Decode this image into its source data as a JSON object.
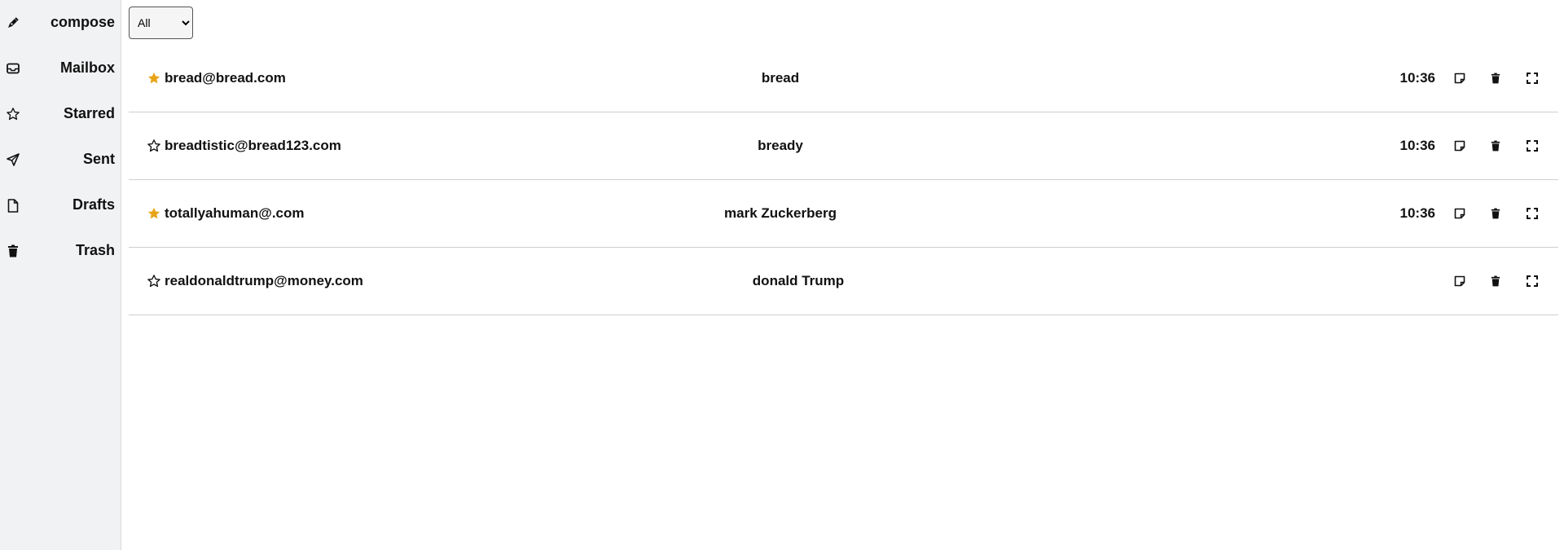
{
  "sidebar": {
    "items": [
      {
        "label": "compose",
        "icon": "pen-icon"
      },
      {
        "label": "Mailbox",
        "icon": "inbox-icon"
      },
      {
        "label": "Starred",
        "icon": "star-outline-icon"
      },
      {
        "label": "Sent",
        "icon": "send-icon"
      },
      {
        "label": "Drafts",
        "icon": "file-icon"
      },
      {
        "label": "Trash",
        "icon": "trash-icon"
      }
    ]
  },
  "filter": {
    "selected": "All",
    "options": [
      "All"
    ]
  },
  "emails": [
    {
      "sender": "bread@bread.com",
      "subject": "bread",
      "time": "10:36",
      "starred": true
    },
    {
      "sender": "breadtistic@bread123.com",
      "subject": "bready",
      "time": "10:36",
      "starred": false
    },
    {
      "sender": "totallyahuman@.com",
      "subject": "mark Zuckerberg",
      "time": "10:36",
      "starred": true
    },
    {
      "sender": "realdonaldtrump@money.com",
      "subject": "donald Trump",
      "time": "",
      "starred": false
    }
  ],
  "colors": {
    "star_filled": "#e8a317",
    "sidebar_bg": "#f1f2f4",
    "divider": "#cfcfcf"
  },
  "row_icons": [
    "note-icon",
    "trash-icon",
    "expand-icon"
  ]
}
